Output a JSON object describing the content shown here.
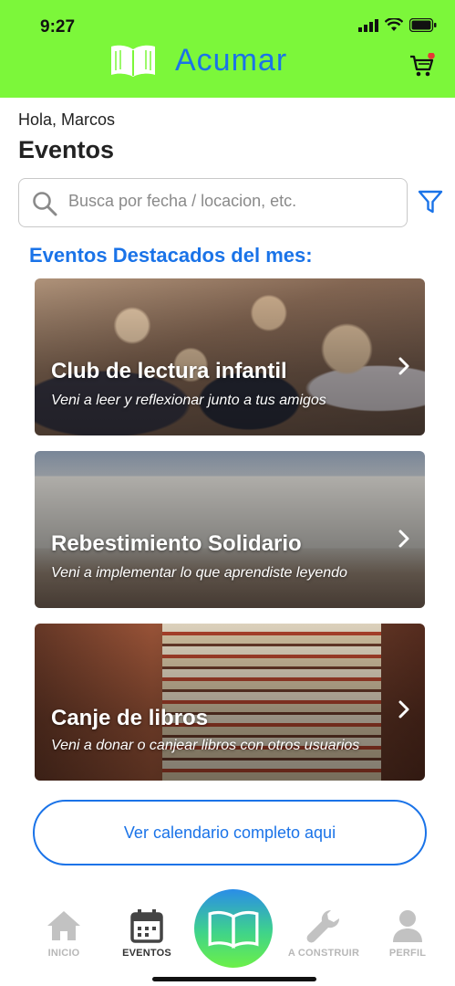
{
  "status_bar": {
    "time": "9:27"
  },
  "brand": {
    "name": "Acumar",
    "accent": "#1a73e8",
    "header_bg": "#7cf73a"
  },
  "greeting": "Hola, Marcos",
  "page_title": "Eventos",
  "search": {
    "placeholder": "Busca por fecha / locacion, etc.",
    "value": ""
  },
  "featured_title": "Eventos Destacados del mes:",
  "events": [
    {
      "title": "Club de lectura infantil",
      "subtitle": "Veni a leer y reflexionar junto a tus amigos"
    },
    {
      "title": "Rebestimiento Solidario",
      "subtitle": "Veni a implementar lo que aprendiste leyendo"
    },
    {
      "title": "Canje de libros",
      "subtitle": "Veni a donar o canjear libros con otros usuarios"
    }
  ],
  "cta_label": "Ver calendario completo aqui",
  "nav": {
    "items": [
      {
        "label": "INICIO",
        "icon": "home-icon",
        "active": false
      },
      {
        "label": "EVENTOS",
        "icon": "calendar-icon",
        "active": true
      },
      {
        "label": "",
        "icon": "book-icon",
        "active": false
      },
      {
        "label": "A CONSTRUIR",
        "icon": "wrench-icon",
        "active": false
      },
      {
        "label": "PERFIL",
        "icon": "user-icon",
        "active": false
      }
    ]
  }
}
